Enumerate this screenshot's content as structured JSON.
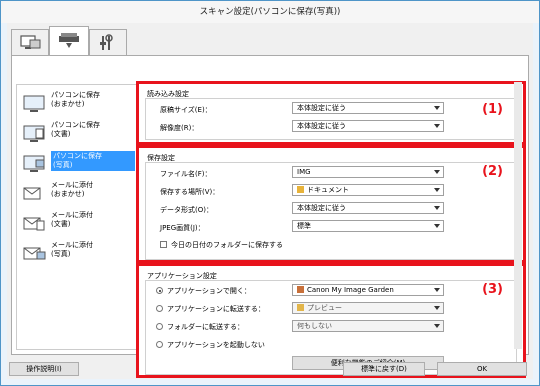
{
  "window": {
    "title": "スキャン設定(パソコンに保存(写真))"
  },
  "tabs": [
    "scan-from-computer",
    "scanner-settings",
    "general-settings"
  ],
  "sidebar": {
    "items": [
      {
        "label": "パソコンに保存\n(おまかせ)"
      },
      {
        "label": "パソコンに保存\n(文書)"
      },
      {
        "label": "パソコンに保存\n(写真)"
      },
      {
        "label": "メールに添付\n(おまかせ)"
      },
      {
        "label": "メールに添付\n(文書)"
      },
      {
        "label": "メールに添付\n(写真)"
      }
    ]
  },
  "scan_options": {
    "title": "読み込み設定",
    "number": "(1)",
    "paper_size_label": "原稿サイズ(E)：",
    "paper_size_value": "本体設定に従う",
    "resolution_label": "解像度(R)：",
    "resolution_value": "本体設定に従う"
  },
  "save_settings": {
    "title": "保存設定",
    "number": "(2)",
    "file_name_label": "ファイル名(F)：",
    "file_name_value": "IMG",
    "save_in_label": "保存する場所(V)：",
    "save_in_value": "ドキュメント",
    "data_format_label": "データ形式(O)：",
    "data_format_value": "本体設定に従う",
    "jpeg_quality_label": "JPEG画質(J)：",
    "jpeg_quality_value": "標準",
    "subfolder_label": "今日の日付のフォルダーに保存する"
  },
  "app_settings": {
    "title": "アプリケーション設定",
    "number": "(3)",
    "open_app_label": "アプリケーションで開く：",
    "open_app_value": "Canon My Image Garden",
    "send_app_label": "アプリケーションに転送する：",
    "send_app_value": "プレビュー",
    "send_folder_label": "フォルダーに転送する：",
    "send_folder_value": "何もしない",
    "no_app_label": "アプリケーションを起動しない",
    "more_functions_label": "便利な機能のご紹介(M)"
  },
  "footer": {
    "instructions_label": "操作説明(I)",
    "defaults_label": "標準に戻す(D)",
    "ok_label": "OK"
  }
}
